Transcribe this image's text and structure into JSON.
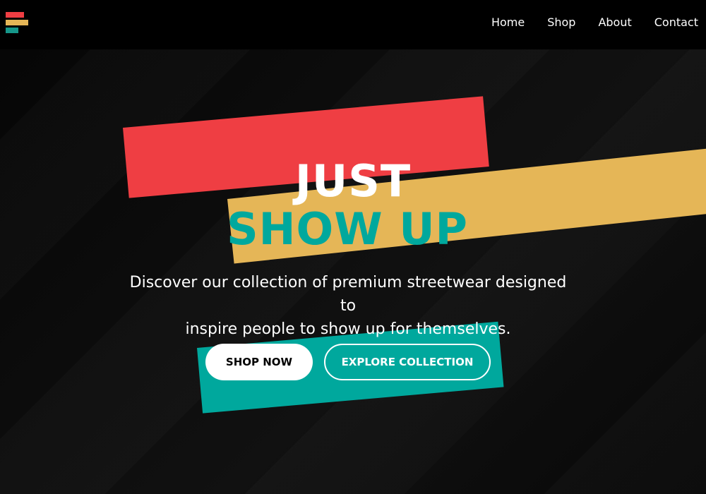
{
  "colors": {
    "red": "#ef3e43",
    "yellow": "#e5b657",
    "teal": "#00a89d",
    "background": "#0b0b0b",
    "header": "#000000",
    "white": "#ffffff"
  },
  "logo": {
    "icon": "stacked-bars-logo-icon"
  },
  "nav": {
    "items": [
      {
        "label": "Home"
      },
      {
        "label": "Shop"
      },
      {
        "label": "About"
      },
      {
        "label": "Contact"
      }
    ]
  },
  "hero": {
    "headline_line1": "JUST",
    "headline_line2": "SHOW UP",
    "subtitle_line1": "Discover our collection of premium streetwear designed to",
    "subtitle_line2": "inspire people to show up for themselves.",
    "primary_button": "SHOP NOW",
    "secondary_button": "EXPLORE COLLECTION"
  }
}
